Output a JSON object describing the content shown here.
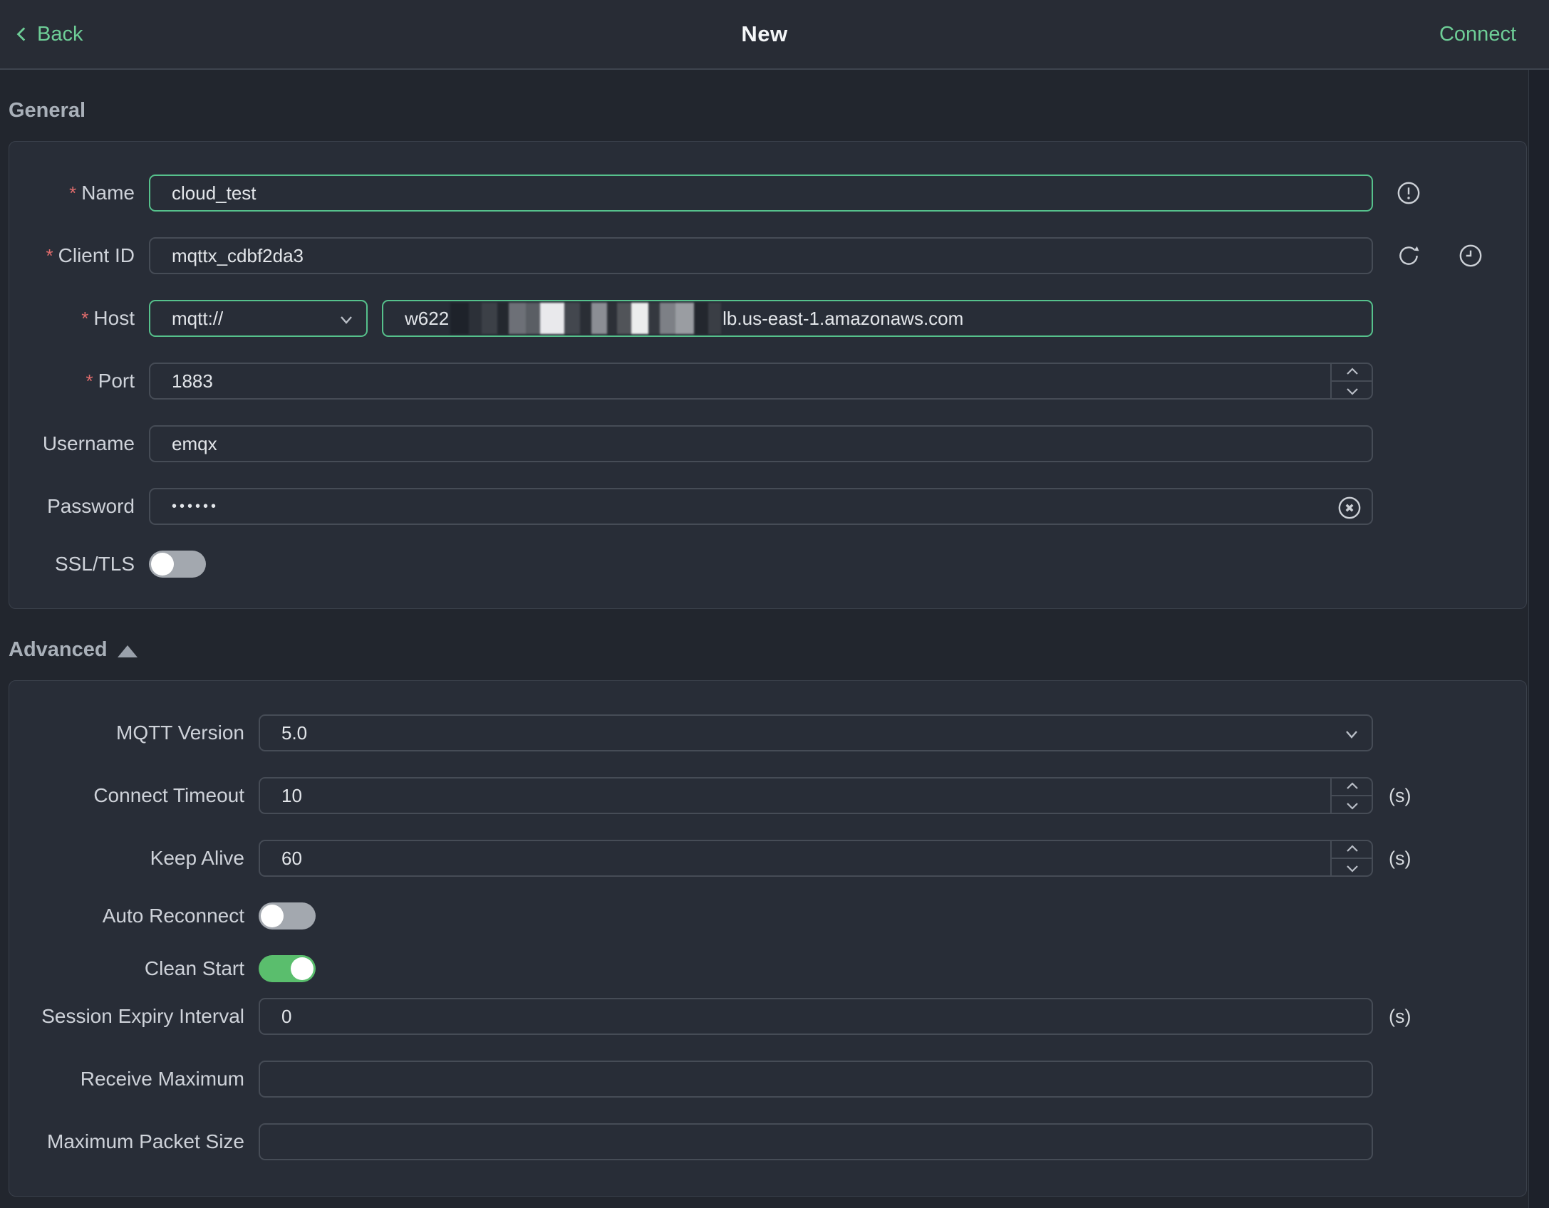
{
  "topbar": {
    "back_label": "Back",
    "title": "New",
    "connect_label": "Connect"
  },
  "misc": {
    "required_mark": "*"
  },
  "colors": {
    "accent_green": "#6ece97",
    "focus_border_green": "#56c18c",
    "toggle_on_green": "#5abe6d",
    "required_red": "#e06c6c"
  },
  "sections": {
    "general_title": "General",
    "advanced_title": "Advanced"
  },
  "general": {
    "name": {
      "label": "Name",
      "required": true,
      "value": "cloud_test"
    },
    "client_id": {
      "label": "Client ID",
      "required": true,
      "value": "mqttx_cdbf2da3"
    },
    "host": {
      "label": "Host",
      "required": true,
      "protocol": "mqtt://",
      "value_prefix": "w622",
      "value_redacted": true,
      "value_suffix": "lb.us-east-1.amazonaws.com"
    },
    "port": {
      "label": "Port",
      "required": true,
      "value": "1883"
    },
    "username": {
      "label": "Username",
      "value": "emqx"
    },
    "password": {
      "label": "Password",
      "value": "••••••"
    },
    "ssl_tls": {
      "label": "SSL/TLS",
      "value": false
    }
  },
  "advanced": {
    "mqtt_version": {
      "label": "MQTT Version",
      "value": "5.0"
    },
    "connect_timeout": {
      "label": "Connect Timeout",
      "value": "10",
      "unit": "(s)"
    },
    "keep_alive": {
      "label": "Keep Alive",
      "value": "60",
      "unit": "(s)"
    },
    "auto_reconnect": {
      "label": "Auto Reconnect",
      "value": false
    },
    "clean_start": {
      "label": "Clean Start",
      "value": true
    },
    "session_expiry": {
      "label": "Session Expiry Interval",
      "value": "0",
      "unit": "(s)"
    },
    "receive_maximum": {
      "label": "Receive Maximum",
      "value": ""
    },
    "max_packet_size": {
      "label": "Maximum Packet Size",
      "value": ""
    }
  }
}
